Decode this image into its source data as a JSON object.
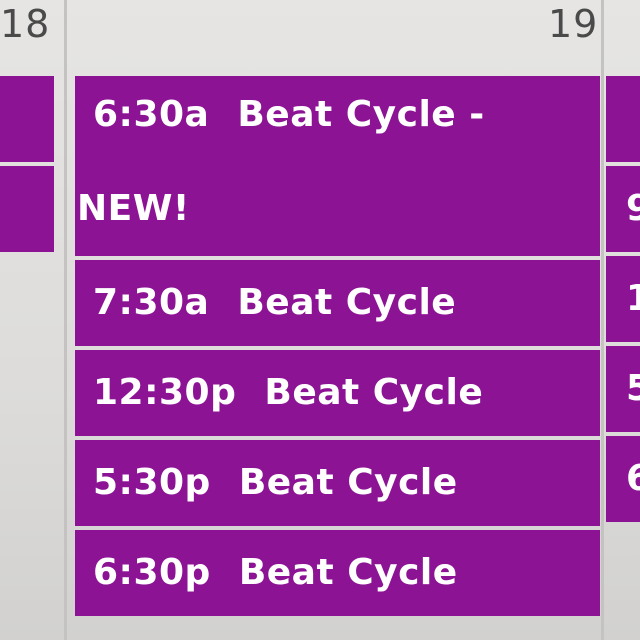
{
  "calendar": {
    "days": [
      {
        "day_number": "18"
      },
      {
        "day_number": "19",
        "events": [
          {
            "time": "6:30a",
            "title": "Beat Cycle -",
            "title_cont": "NEW!"
          },
          {
            "time": "7:30a",
            "title": "Beat Cycle"
          },
          {
            "time": "12:30p",
            "title": "Beat Cycle"
          },
          {
            "time": "5:30p",
            "title": "Beat Cycle"
          },
          {
            "time": "6:30p",
            "title": "Beat Cycle"
          }
        ]
      },
      {
        "partial_events": [
          "",
          "9",
          "1",
          "5",
          "6"
        ]
      }
    ]
  },
  "colors": {
    "event_bg": "#8c1394",
    "event_text": "#ffffff",
    "background": "#e2e1df"
  }
}
